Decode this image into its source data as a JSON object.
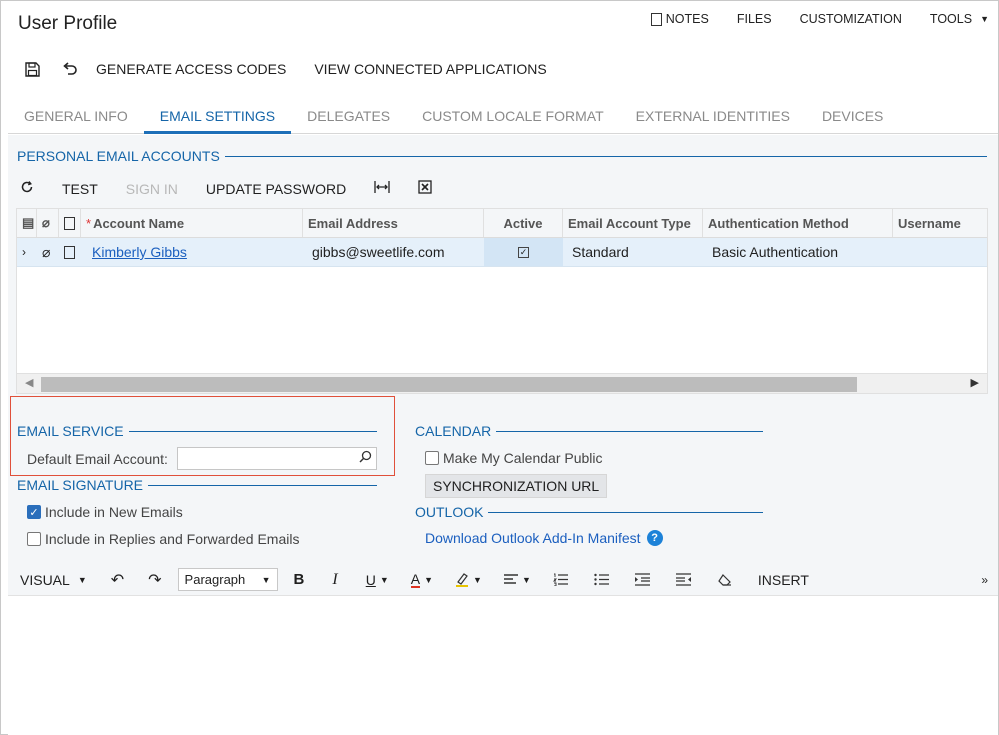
{
  "page": {
    "title": "User Profile"
  },
  "topnav": [
    {
      "label": "NOTES",
      "icon": "document-icon"
    },
    {
      "label": "FILES"
    },
    {
      "label": "CUSTOMIZATION"
    },
    {
      "label": "TOOLS",
      "icon": "caret-down-icon"
    }
  ],
  "toolbar": {
    "save_icon": "💾",
    "undo_icon": "↶",
    "generate": "GENERATE ACCESS CODES",
    "view_connected": "VIEW CONNECTED APPLICATIONS"
  },
  "tabs": [
    {
      "label": "GENERAL INFO",
      "active": false
    },
    {
      "label": "EMAIL SETTINGS",
      "active": true
    },
    {
      "label": "DELEGATES",
      "active": false
    },
    {
      "label": "CUSTOM LOCALE FORMAT",
      "active": false
    },
    {
      "label": "EXTERNAL IDENTITIES",
      "active": false
    },
    {
      "label": "DEVICES",
      "active": false
    }
  ],
  "personal": {
    "title": "PERSONAL EMAIL ACCOUNTS",
    "toolbar": {
      "test": "TEST",
      "sign_in": "SIGN IN",
      "update_password": "UPDATE PASSWORD"
    },
    "columns": {
      "account_name": "Account Name",
      "email_address": "Email Address",
      "active": "Active",
      "email_account_type": "Email Account Type",
      "auth_method": "Authentication Method",
      "username": "Username"
    },
    "rows": [
      {
        "account_name": "Kimberly Gibbs",
        "email_address": "gibbs@sweetlife.com",
        "active": true,
        "email_account_type": "Standard",
        "auth_method": "Basic Authentication",
        "username": ""
      }
    ]
  },
  "email_service": {
    "title": "EMAIL SERVICE",
    "default_label": "Default Email Account:",
    "default_value": ""
  },
  "email_signature": {
    "title": "EMAIL SIGNATURE",
    "include_new": "Include in New Emails",
    "include_new_checked": true,
    "include_replies": "Include in Replies and Forwarded Emails",
    "include_replies_checked": false
  },
  "calendar": {
    "title": "CALENDAR",
    "make_public": "Make My Calendar Public",
    "make_public_checked": false,
    "sync_url": "SYNCHRONIZATION URL"
  },
  "outlook": {
    "title": "OUTLOOK",
    "download": "Download Outlook Add-In Manifest"
  },
  "editor": {
    "mode": "VISUAL",
    "paragraph": "Paragraph",
    "insert": "INSERT"
  },
  "colors": {
    "accent": "#1565a8",
    "highlight_box": "#e0503a",
    "selected_row": "#e5f0fa"
  }
}
